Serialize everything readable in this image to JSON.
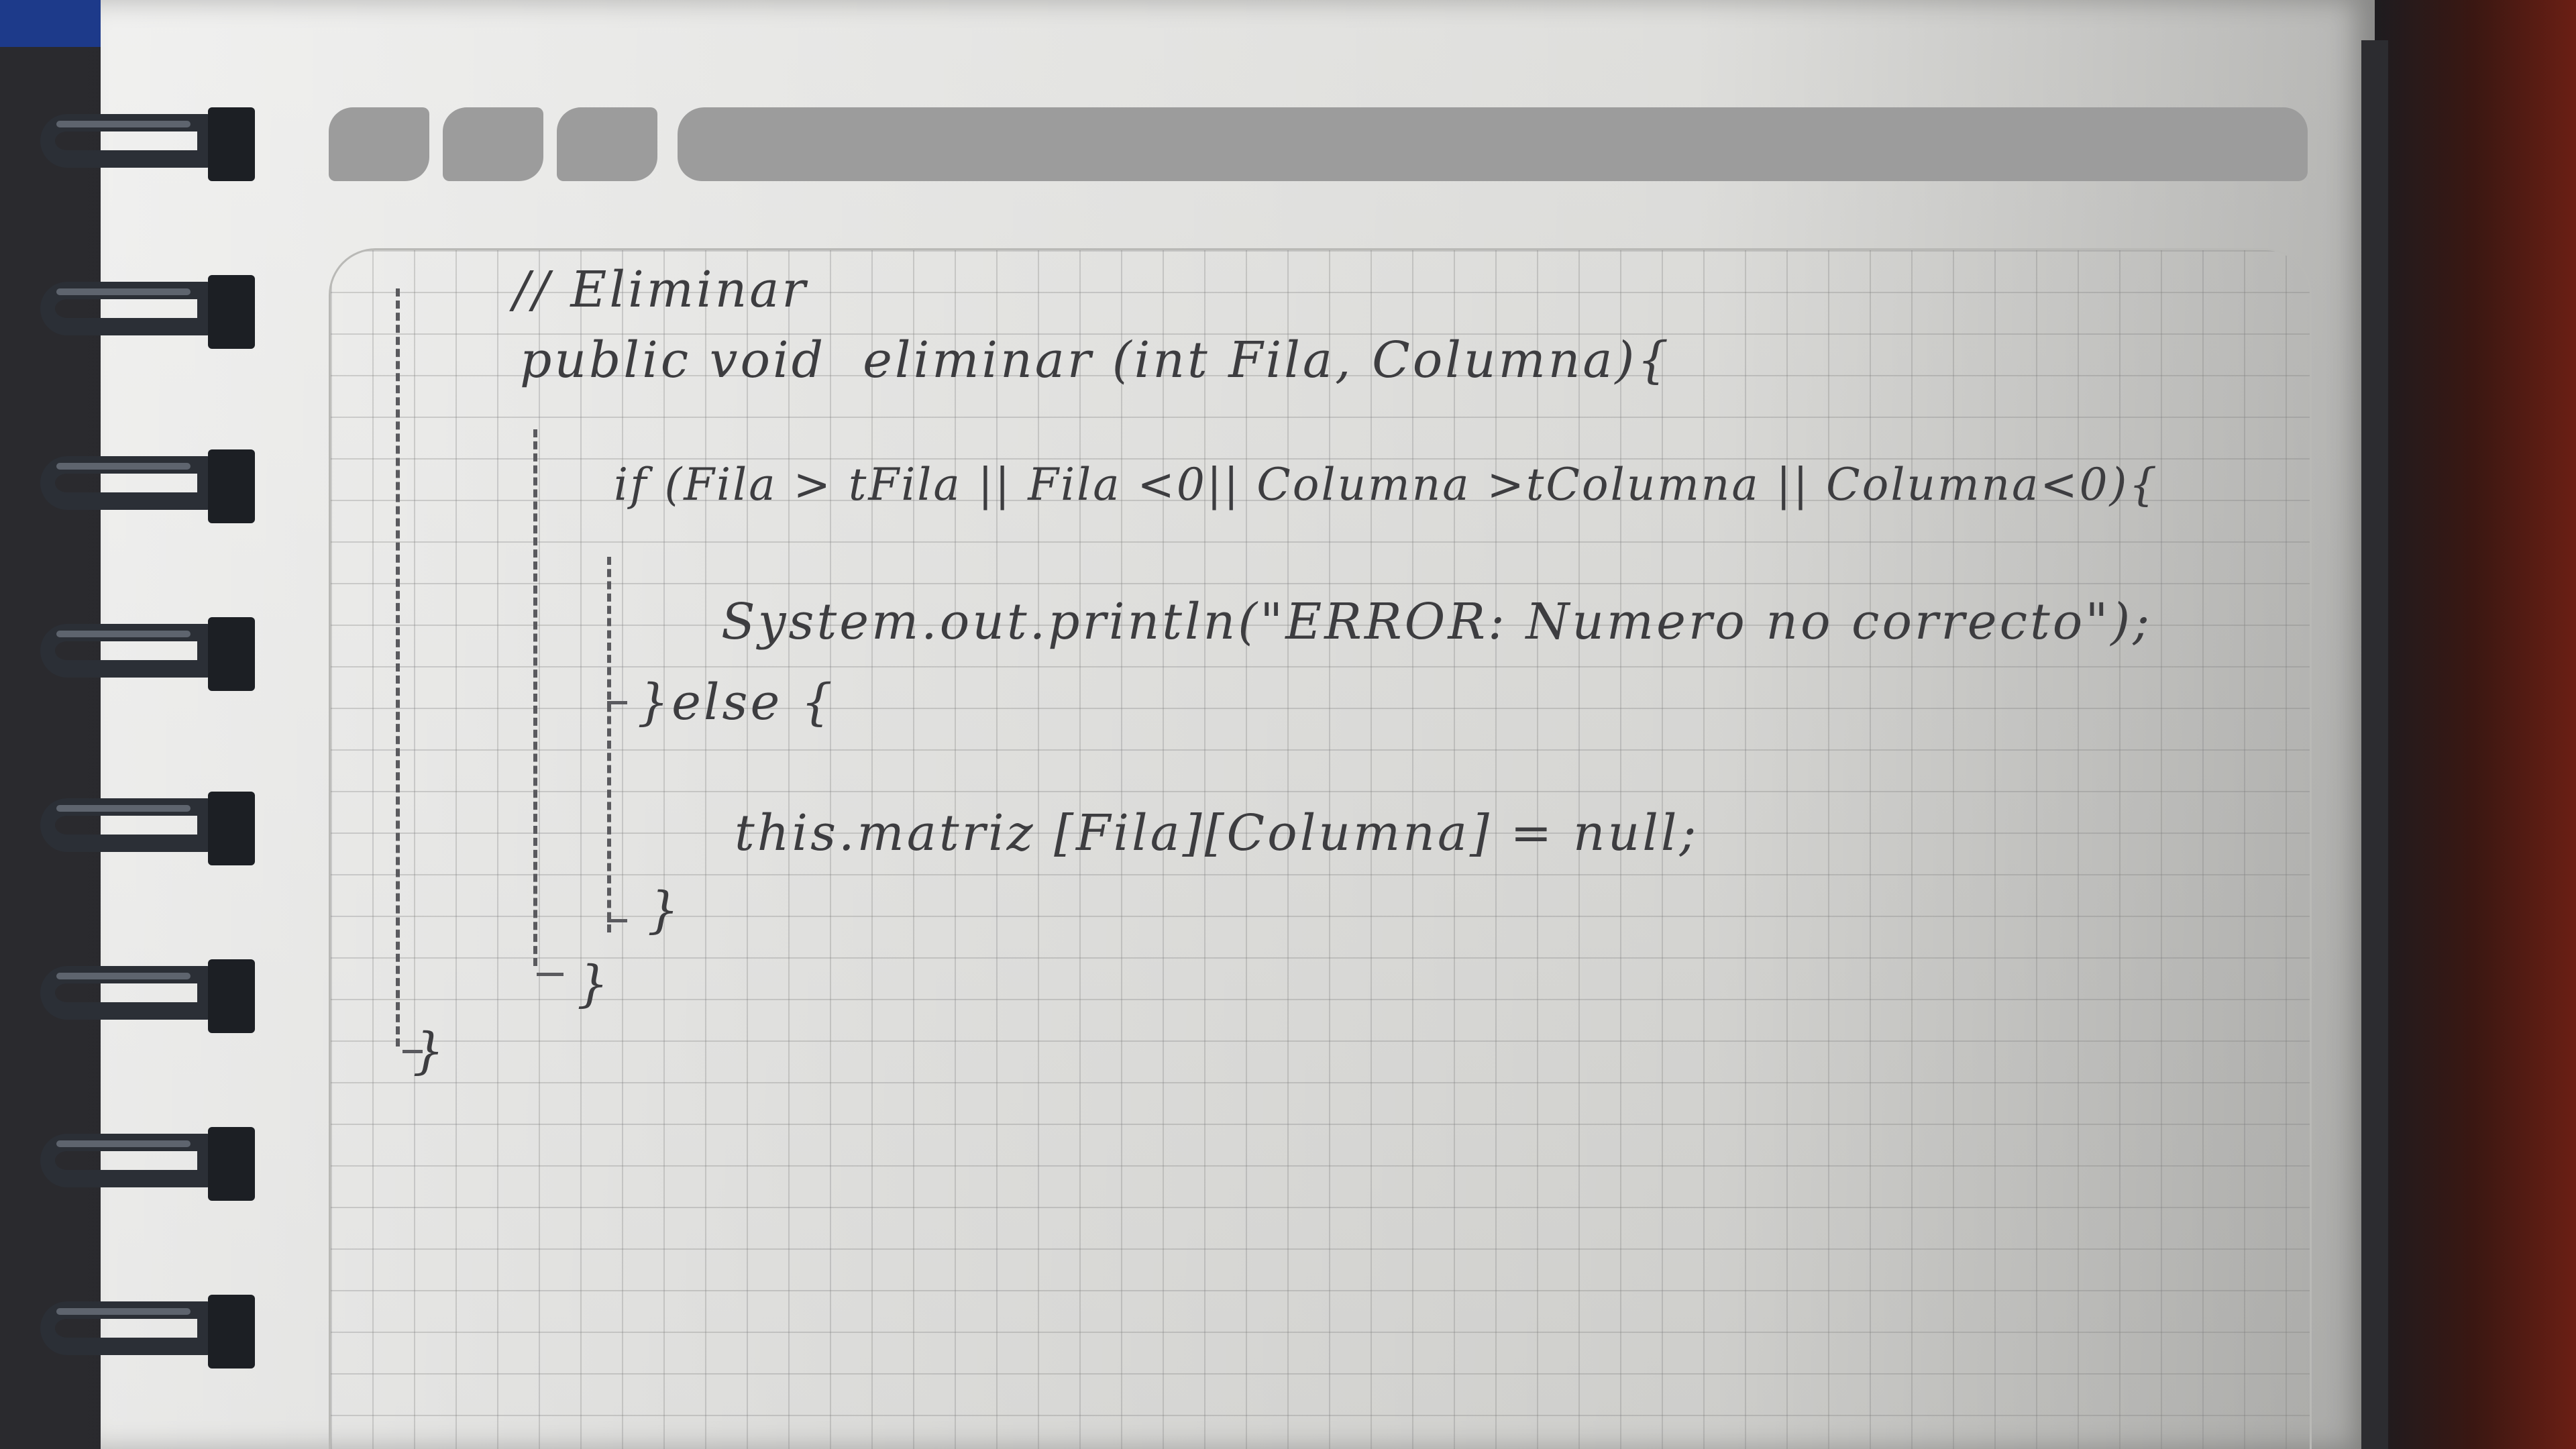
{
  "notebook": {
    "comment": "// Eliminar",
    "code_lines": [
      "public void  eliminar (int Fila, Columna){",
      "if (Fila > tFila || Fila <0|| Columna >tColumna || Columna<0){",
      "System.out.println(\"ERROR: Numero no correcto\");",
      "}else {",
      "this.matriz [Fila][Columna] = null;",
      "}",
      "}",
      "}"
    ]
  }
}
